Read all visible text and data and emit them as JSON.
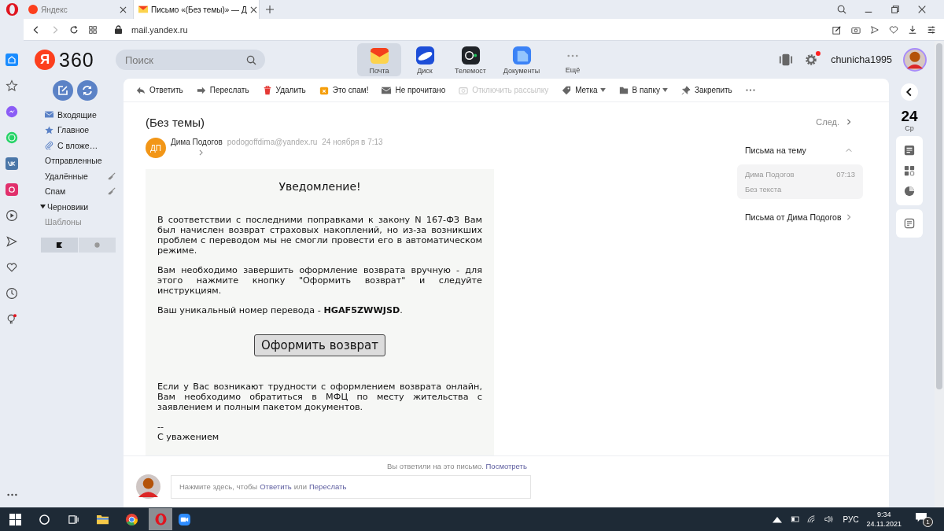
{
  "browser_tabs": [
    {
      "title": "Яндекс",
      "selected": false
    },
    {
      "title": "Письмо «(Без темы)» — Д",
      "selected": true
    }
  ],
  "address": "mail.yandex.ru",
  "header": {
    "logo_mark": "Я",
    "logo_text": "360",
    "search_placeholder": "Поиск",
    "username": "chunicha1995",
    "settings_notification": true
  },
  "apps": [
    {
      "label": "Почта",
      "selected": true
    },
    {
      "label": "Диск",
      "selected": false
    },
    {
      "label": "Телемост",
      "selected": false
    },
    {
      "label": "Документы",
      "selected": false
    },
    {
      "label": "Ещё",
      "selected": false
    }
  ],
  "theme_modes": [
    {
      "selected": true
    },
    {
      "selected": false
    }
  ],
  "folders": [
    {
      "label": "Входящие",
      "kind": "main",
      "cleanable": false
    },
    {
      "label": "Главное",
      "kind": "main",
      "cleanable": false
    },
    {
      "label": "С вложе…",
      "kind": "main",
      "cleanable": false
    },
    {
      "label": "Отправленные",
      "kind": "folder",
      "cleanable": false
    },
    {
      "label": "Удалённые",
      "kind": "folder",
      "cleanable": true
    },
    {
      "label": "Спам",
      "kind": "folder",
      "cleanable": true
    },
    {
      "label": "Черновики",
      "kind": "folder",
      "cleanable": false,
      "expanded": true,
      "children": [
        {
          "label": "Шаблоны",
          "kind": "template",
          "cleanable": false
        }
      ]
    }
  ],
  "toolbar": [
    {
      "label": "Ответить",
      "disabled": false,
      "dropdown": false
    },
    {
      "label": "Переслать",
      "disabled": false,
      "dropdown": false
    },
    {
      "label": "Удалить",
      "disabled": false,
      "dropdown": false
    },
    {
      "label": "Это спам!",
      "disabled": false,
      "dropdown": false
    },
    {
      "label": "Не прочитано",
      "disabled": false,
      "dropdown": false
    },
    {
      "label": "Отключить рассылку",
      "disabled": true,
      "dropdown": false
    },
    {
      "label": "Метка",
      "disabled": false,
      "dropdown": true
    },
    {
      "label": "В папку",
      "disabled": false,
      "dropdown": true
    },
    {
      "label": "Закрепить",
      "disabled": false,
      "dropdown": false
    }
  ],
  "message": {
    "subject": "(Без темы)",
    "sender_initials": "ДП",
    "sender_name": "Дима Подогов",
    "sender_email": "podogoffdima@yandex.ru",
    "date": "24 ноября в 7:13",
    "next": "След.",
    "letter": {
      "title": "Уведомление!",
      "paragraphs_top": [
        "В соответствии с последними поправками к закону N 167-ФЗ Вам был начислен возврат страховых накоплений, но из-за возникших проблем с переводом мы не смогли провести его в автоматическом режиме.",
        "Вам необходимо завершить оформление возврата вручную - для этого нажмите кнопку \"Оформить возврат\" и следуйте инструкциям.",
        "Ваш уникальный номер перевода - **HGAF5ZWWJSD**."
      ],
      "button": "Оформить возврат",
      "paragraphs_bottom": [
        "Если у Вас возникают трудности с оформлением возврата онлайн, Вам необходимо обратиться в МФЦ по месту жительства с заявлением и полным пакетом документов."
      ],
      "signature": [
        "--",
        "С уважением"
      ]
    }
  },
  "thread": {
    "title": "Письма на тему",
    "expanded": true,
    "items": [
      {
        "sender": "Дима Подогов",
        "time": "07:13",
        "snippet": "Без текста"
      }
    ],
    "from_sender": "Письма от Дима Подогов"
  },
  "rail": {
    "day": "24",
    "weekday": "Ср"
  },
  "reply": {
    "note": "Вы ответили на это письмо.",
    "note_link": "Посмотреть",
    "prompt_before": "Нажмите здесь, чтобы",
    "prompt_link1": "Ответить",
    "prompt_middle": "или",
    "prompt_link2": "Переслать"
  },
  "taskbar": {
    "language": "РУС",
    "time": "9:34",
    "date": "24.11.2021",
    "notifications": "1"
  }
}
